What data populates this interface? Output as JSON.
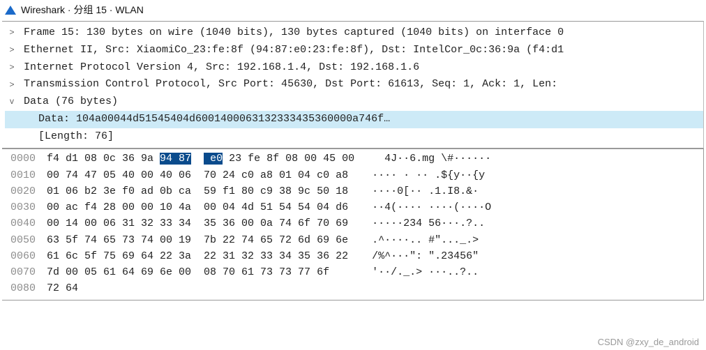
{
  "title": "Wireshark · 分组 15 · WLAN",
  "tree": {
    "nodes": [
      {
        "toggle": ">",
        "expanded": false,
        "text": "Frame 15: 130 bytes on wire (1040 bits), 130 bytes captured (1040 bits) on interface 0"
      },
      {
        "toggle": ">",
        "expanded": false,
        "text": "Ethernet II, Src: XiaomiCo_23:fe:8f (94:87:e0:23:fe:8f), Dst: IntelCor_0c:36:9a (f4:d1"
      },
      {
        "toggle": ">",
        "expanded": false,
        "text": "Internet Protocol Version 4, Src: 192.168.1.4, Dst: 192.168.1.6"
      },
      {
        "toggle": ">",
        "expanded": false,
        "text": "Transmission Control Protocol, Src Port: 45630, Dst Port: 61613, Seq: 1, Ack: 1, Len:"
      },
      {
        "toggle": "v",
        "expanded": true,
        "text": "Data (76 bytes)"
      }
    ],
    "data_children": [
      {
        "text": "Data: 104a00044d51545404d6001400063132333435360000a746f…",
        "selected": true
      },
      {
        "text": "[Length: 76]",
        "selected": false
      }
    ]
  },
  "hex": {
    "highlight_row": 0,
    "highlight_start_byte": 6,
    "highlight_end_byte": 8,
    "rows": [
      {
        "offset": "0000",
        "bytes": [
          "f4",
          "d1",
          "08",
          "0c",
          "36",
          "9a",
          "94",
          "87",
          "e0",
          "23",
          "fe",
          "8f",
          "08",
          "00",
          "45",
          "00"
        ],
        "ascii": " 4J··6.mg \\#······"
      },
      {
        "offset": "0010",
        "bytes": [
          "00",
          "74",
          "47",
          "05",
          "40",
          "00",
          "40",
          "06",
          "70",
          "24",
          "c0",
          "a8",
          "01",
          "04",
          "c0",
          "a8"
        ],
        "ascii": "···· · ·· .${y··{y"
      },
      {
        "offset": "0020",
        "bytes": [
          "01",
          "06",
          "b2",
          "3e",
          "f0",
          "ad",
          "0b",
          "ca",
          "59",
          "f1",
          "80",
          "c9",
          "38",
          "9c",
          "50",
          "18"
        ],
        "ascii": "····0[·· .1.I8.&·"
      },
      {
        "offset": "0030",
        "bytes": [
          "00",
          "ac",
          "f4",
          "28",
          "00",
          "00",
          "10",
          "4a",
          "00",
          "04",
          "4d",
          "51",
          "54",
          "54",
          "04",
          "d6"
        ],
        "ascii": "··4(···· ····(····O"
      },
      {
        "offset": "0040",
        "bytes": [
          "00",
          "14",
          "00",
          "06",
          "31",
          "32",
          "33",
          "34",
          "35",
          "36",
          "00",
          "0a",
          "74",
          "6f",
          "70",
          "69"
        ],
        "ascii": "·····234 56···.?.."
      },
      {
        "offset": "0050",
        "bytes": [
          "63",
          "5f",
          "74",
          "65",
          "73",
          "74",
          "00",
          "19",
          "7b",
          "22",
          "74",
          "65",
          "72",
          "6d",
          "69",
          "6e"
        ],
        "ascii": ".^····.. #\"..._.>"
      },
      {
        "offset": "0060",
        "bytes": [
          "61",
          "6c",
          "5f",
          "75",
          "69",
          "64",
          "22",
          "3a",
          "22",
          "31",
          "32",
          "33",
          "34",
          "35",
          "36",
          "22"
        ],
        "ascii": "/%^···\": \".23456\""
      },
      {
        "offset": "0070",
        "bytes": [
          "7d",
          "00",
          "05",
          "61",
          "64",
          "69",
          "6e",
          "00",
          "08",
          "70",
          "61",
          "73",
          "73",
          "77",
          "6f"
        ],
        "ascii": "'··/._.> ···..?.."
      },
      {
        "offset": "0080",
        "bytes": [
          "72",
          "64"
        ],
        "ascii": ""
      }
    ]
  },
  "watermark": "CSDN @zxy_de_android"
}
